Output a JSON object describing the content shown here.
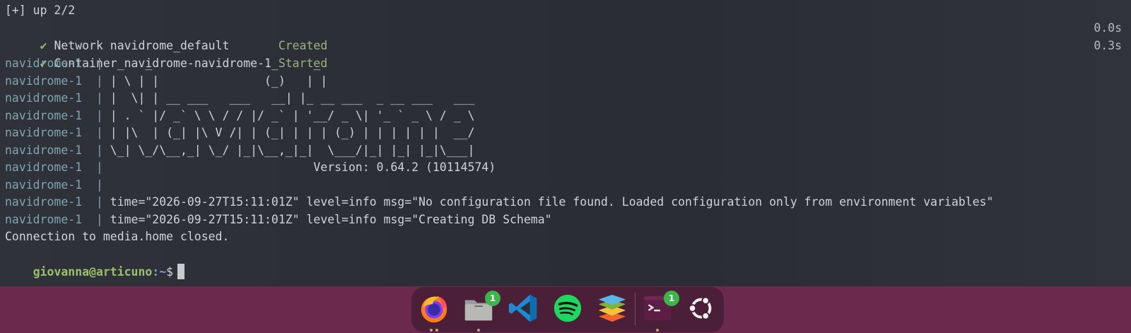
{
  "terminal": {
    "header": "[+] up 2/2",
    "checkmark": "✔",
    "network": {
      "label": "Network navidrome_default      ",
      "status": "Created",
      "duration": "0.0s"
    },
    "container": {
      "label": "Container navidrome-navidrome-1",
      "status": "Started",
      "duration": "0.3s"
    },
    "log_prefix": "navidrome-1  | ",
    "logs": [
      " _   _                 _     _",
      "| \\ | |               (_)   | |",
      "|  \\| | __ ___   ___   __| |_ __ ___  _ __ ___   ___",
      "| . ` |/ _` \\ \\ / / |/ _` | '__/ _ \\| '_ ` _ \\ / _ \\",
      "| |\\  | (_| |\\ V /| | (_| | | | (_) | | | | | |  __/",
      "\\_| \\_/\\__,_| \\_/ |_|\\__,_|_|  \\___/|_| |_| |_|\\___|",
      "                             Version: 0.64.2 (10114574)",
      "",
      "time=\"2026-09-27T15:11:01Z\" level=info msg=\"No configuration file found. Loaded configuration only from environment variables\"",
      "time=\"2026-09-27T15:11:01Z\" level=info msg=\"Creating DB Schema\""
    ],
    "closed_msg": "Connection to media.home closed.",
    "prompt_user": "giovanna@articuno",
    "prompt_path": ":~",
    "prompt_symbol": "$"
  },
  "dock": {
    "items": [
      {
        "name": "firefox-icon",
        "badge": ""
      },
      {
        "name": "files-icon",
        "badge": "1"
      },
      {
        "name": "vscode-icon",
        "badge": ""
      },
      {
        "name": "spotify-icon",
        "badge": ""
      },
      {
        "name": "layers-app-icon",
        "badge": ""
      },
      {
        "name": "terminal-icon",
        "badge": "1"
      },
      {
        "name": "ubuntu-apps-icon",
        "badge": ""
      }
    ]
  },
  "colors": {
    "terminal_bg": "#2b2e35",
    "dock_bar": "#6b2a4d",
    "dock": "#4a1f37",
    "prefix": "#7fa6b2",
    "status": "#9bb27c",
    "badge": "#3cb54a"
  }
}
